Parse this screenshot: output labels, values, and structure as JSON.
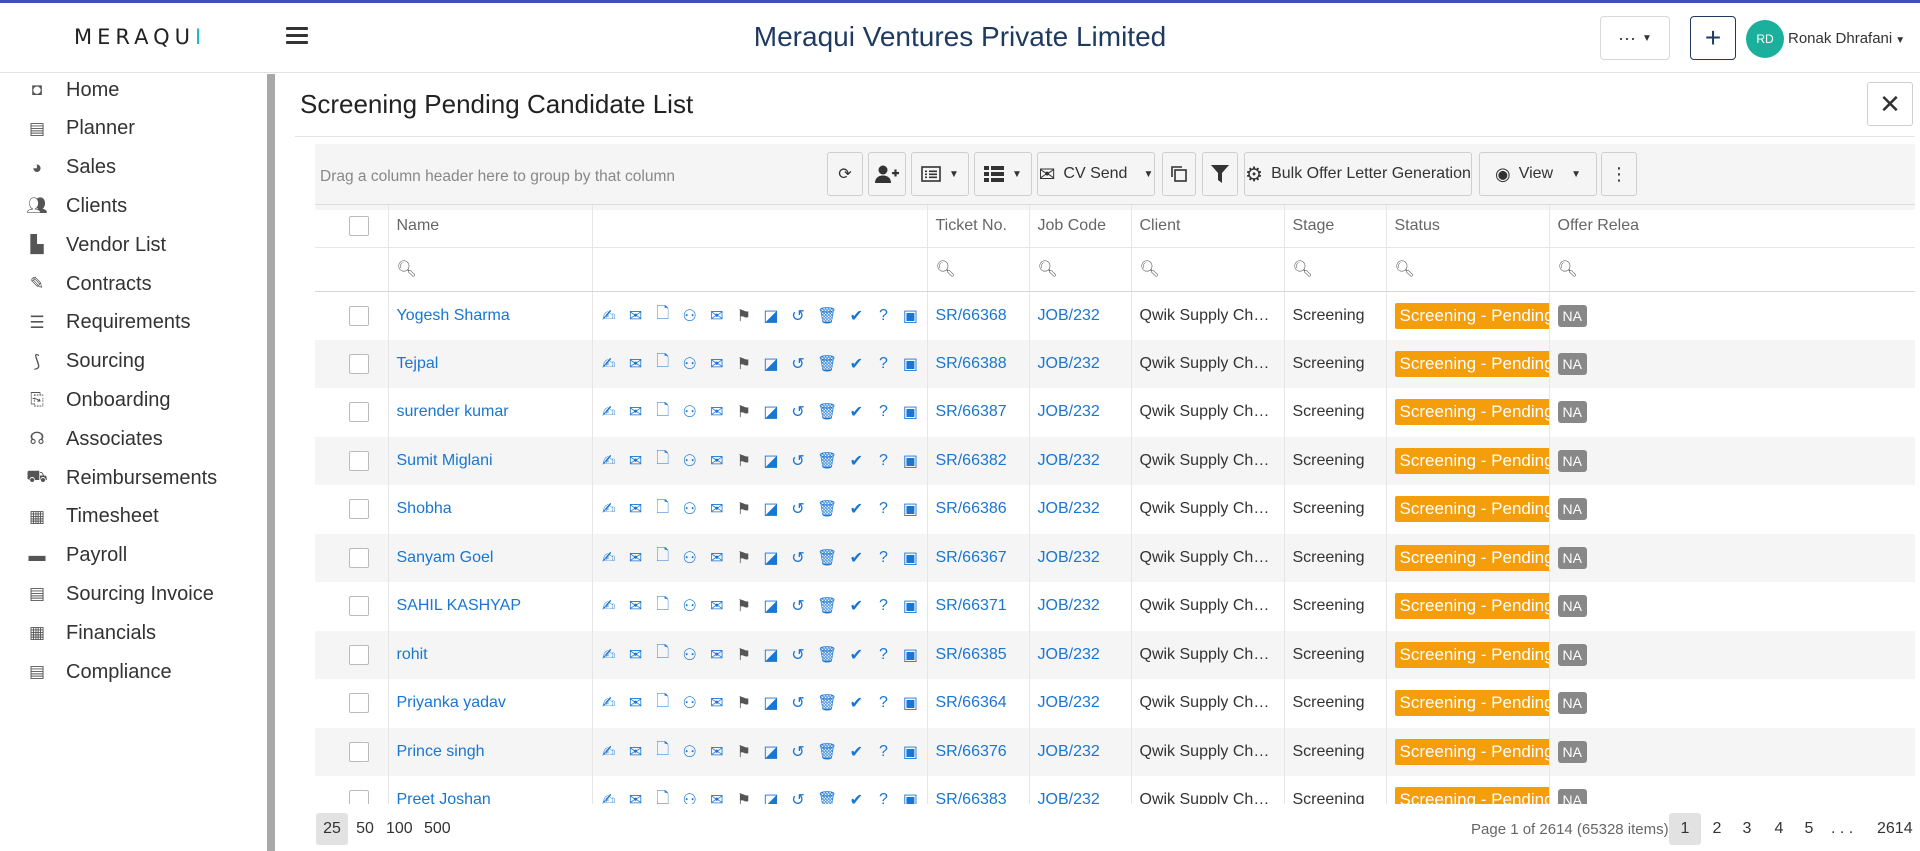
{
  "header": {
    "logo": "MERAQU",
    "logo_accent": "I",
    "company": "Meraqui Ventures Private Limited",
    "more_label": "···",
    "add_label": "+",
    "avatar_initials": "RD",
    "user_name": "Ronak Dhrafani"
  },
  "sidebar": {
    "items": [
      {
        "label": "Home",
        "icon": "home-icon"
      },
      {
        "label": "Planner",
        "icon": "planner-icon"
      },
      {
        "label": "Sales",
        "icon": "pie-chart-icon"
      },
      {
        "label": "Clients",
        "icon": "users-icon"
      },
      {
        "label": "Vendor List",
        "icon": "chart-icon"
      },
      {
        "label": "Contracts",
        "icon": "contract-icon"
      },
      {
        "label": "Requirements",
        "icon": "list-icon"
      },
      {
        "label": "Sourcing",
        "icon": "sourcing-icon"
      },
      {
        "label": "Onboarding",
        "icon": "onboarding-icon"
      },
      {
        "label": "Associates",
        "icon": "headset-icon"
      },
      {
        "label": "Reimbursements",
        "icon": "reimburse-icon"
      },
      {
        "label": "Timesheet",
        "icon": "calendar-icon"
      },
      {
        "label": "Payroll",
        "icon": "card-icon"
      },
      {
        "label": "Sourcing Invoice",
        "icon": "invoice-icon"
      },
      {
        "label": "Financials",
        "icon": "calculator-icon"
      },
      {
        "label": "Compliance",
        "icon": "compliance-icon"
      }
    ]
  },
  "main": {
    "title": "Screening Pending Candidate List",
    "group_hint": "Drag a column header here to group by that column",
    "cv_send_label": "CV Send",
    "bulk_label": "Bulk Offer Letter Generation",
    "view_label": "View"
  },
  "grid": {
    "columns": [
      "Name",
      "",
      "Ticket No.",
      "Job Code",
      "Client",
      "Stage",
      "Status",
      "Offer Relea"
    ],
    "rows": [
      {
        "name": "Yogesh Sharma",
        "ticket": "SR/66368",
        "job": "JOB/232",
        "client": "Qwik Supply Chain Pvt Ltd",
        "stage": "Screening",
        "status": "Screening - Pending",
        "offer": "NA"
      },
      {
        "name": "Tejpal",
        "ticket": "SR/66388",
        "job": "JOB/232",
        "client": "Qwik Supply Chain Pvt Ltd",
        "stage": "Screening",
        "status": "Screening - Pending",
        "offer": "NA"
      },
      {
        "name": "surender kumar",
        "ticket": "SR/66387",
        "job": "JOB/232",
        "client": "Qwik Supply Chain Pvt Ltd",
        "stage": "Screening",
        "status": "Screening - Pending",
        "offer": "NA"
      },
      {
        "name": "Sumit Miglani",
        "ticket": "SR/66382",
        "job": "JOB/232",
        "client": "Qwik Supply Chain Pvt Ltd",
        "stage": "Screening",
        "status": "Screening - Pending",
        "offer": "NA"
      },
      {
        "name": "Shobha",
        "ticket": "SR/66386",
        "job": "JOB/232",
        "client": "Qwik Supply Chain Pvt Ltd",
        "stage": "Screening",
        "status": "Screening - Pending",
        "offer": "NA"
      },
      {
        "name": "Sanyam Goel",
        "ticket": "SR/66367",
        "job": "JOB/232",
        "client": "Qwik Supply Chain Pvt Ltd",
        "stage": "Screening",
        "status": "Screening - Pending",
        "offer": "NA"
      },
      {
        "name": "SAHIL KASHYAP",
        "ticket": "SR/66371",
        "job": "JOB/232",
        "client": "Qwik Supply Chain Pvt Ltd",
        "stage": "Screening",
        "status": "Screening - Pending",
        "offer": "NA"
      },
      {
        "name": "rohit",
        "ticket": "SR/66385",
        "job": "JOB/232",
        "client": "Qwik Supply Chain Pvt Ltd",
        "stage": "Screening",
        "status": "Screening - Pending",
        "offer": "NA"
      },
      {
        "name": "Priyanka yadav",
        "ticket": "SR/66364",
        "job": "JOB/232",
        "client": "Qwik Supply Chain Pvt Ltd",
        "stage": "Screening",
        "status": "Screening - Pending",
        "offer": "NA"
      },
      {
        "name": "Prince singh",
        "ticket": "SR/66376",
        "job": "JOB/232",
        "client": "Qwik Supply Chain Pvt Ltd",
        "stage": "Screening",
        "status": "Screening - Pending",
        "offer": "NA"
      },
      {
        "name": "Preet Joshan",
        "ticket": "SR/66383",
        "job": "JOB/232",
        "client": "Qwik Supply Chain Pvt Ltd",
        "stage": "Screening",
        "status": "Screening - Pending",
        "offer": "NA"
      }
    ],
    "actions": [
      "edit-user-icon",
      "mail-icon",
      "document-icon",
      "people-icon",
      "envelope-open-icon",
      "flag-icon",
      "note-icon",
      "history-icon",
      "trash-icon",
      "clipboard-check-icon",
      "help-icon",
      "id-card-icon"
    ]
  },
  "pager": {
    "sizes": [
      "25",
      "50",
      "100",
      "500"
    ],
    "info": "Page 1 of 2614 (65328 items)",
    "pages": [
      "1",
      "2",
      "3",
      "4",
      "5",
      ". . .",
      "2614"
    ]
  },
  "colors": {
    "accent": "#1976d2",
    "status": "#f59e0b",
    "avatar": "#1ab09b",
    "title": "#1e3a5f"
  }
}
